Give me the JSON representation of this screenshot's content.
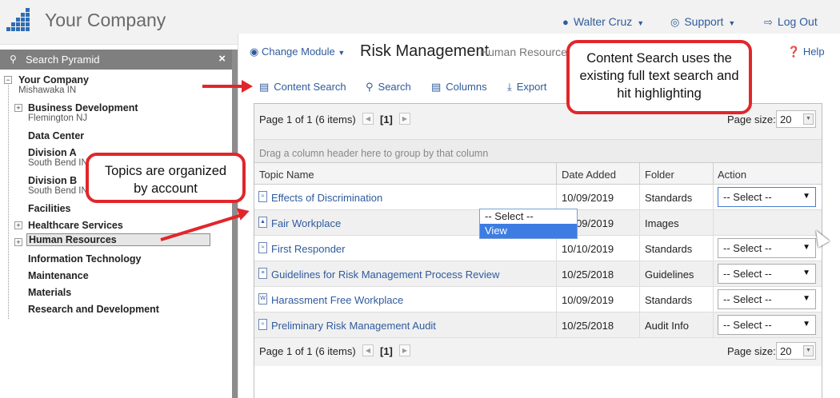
{
  "header": {
    "brand": "Your Company",
    "user": "Walter Cruz",
    "support": "Support",
    "logout": "Log Out"
  },
  "sidebar": {
    "search_label": "Search Pyramid",
    "tree": [
      {
        "label": "Your Company",
        "sub": "Mishawaka IN"
      },
      {
        "label": "Business Development",
        "sub": "Flemington NJ"
      },
      {
        "label": "Data Center",
        "sub": ""
      },
      {
        "label": "Division A",
        "sub": "South Bend IN"
      },
      {
        "label": "Division B",
        "sub": "South Bend IN"
      },
      {
        "label": "Facilities",
        "sub": ""
      },
      {
        "label": "Healthcare Services",
        "sub": ""
      },
      {
        "label": "Human Resources",
        "sub": ""
      },
      {
        "label": "Information Technology",
        "sub": ""
      },
      {
        "label": "Maintenance",
        "sub": ""
      },
      {
        "label": "Materials",
        "sub": ""
      },
      {
        "label": "Research and Development",
        "sub": ""
      }
    ]
  },
  "module": {
    "change_label": "Change Module",
    "title": "Risk Management",
    "subtitle": "Human Resources",
    "help": "Help"
  },
  "toolbar": {
    "content_search": "Content Search",
    "search": "Search",
    "columns": "Columns",
    "export": "Export"
  },
  "grid": {
    "page_info": "Page 1 of 1 (6 items)",
    "page_num": "[1]",
    "page_size_label": "Page size:",
    "page_size": "20",
    "group_hint": "Drag a column header here to group by that column",
    "columns": [
      "Topic Name",
      "Date Added",
      "Folder",
      "Action"
    ],
    "rows": [
      {
        "topic": "Effects of Discrimination",
        "date": "10/09/2019",
        "folder": "Standards",
        "icon": "pdf-icon",
        "action": "-- Select --"
      },
      {
        "topic": "Fair Workplace",
        "date": "10/09/2019",
        "folder": "Images",
        "icon": "image-icon",
        "action": "-- Select --"
      },
      {
        "topic": "First Responder",
        "date": "10/10/2019",
        "folder": "Standards",
        "icon": "pdf-icon",
        "action": "-- Select --"
      },
      {
        "topic": "Guidelines for Risk Management Process Review",
        "date": "10/25/2018",
        "folder": "Guidelines",
        "icon": "doc-icon",
        "action": "-- Select --"
      },
      {
        "topic": "Harassment Free Workplace",
        "date": "10/09/2019",
        "folder": "Standards",
        "icon": "word-icon",
        "action": "-- Select --"
      },
      {
        "topic": "Preliminary Risk Management Audit",
        "date": "10/25/2018",
        "folder": "Audit Info",
        "icon": "pdf-icon",
        "action": "-- Select --"
      }
    ],
    "dropdown_options": [
      "-- Select --",
      "View"
    ]
  },
  "callouts": {
    "content_search": "Content Search uses the existing full text search and hit highlighting",
    "topics": "Topics are organized by account"
  },
  "colors": {
    "accent": "#2f5b9c",
    "callout_border": "#e1262b",
    "highlight": "#3d7de3"
  }
}
